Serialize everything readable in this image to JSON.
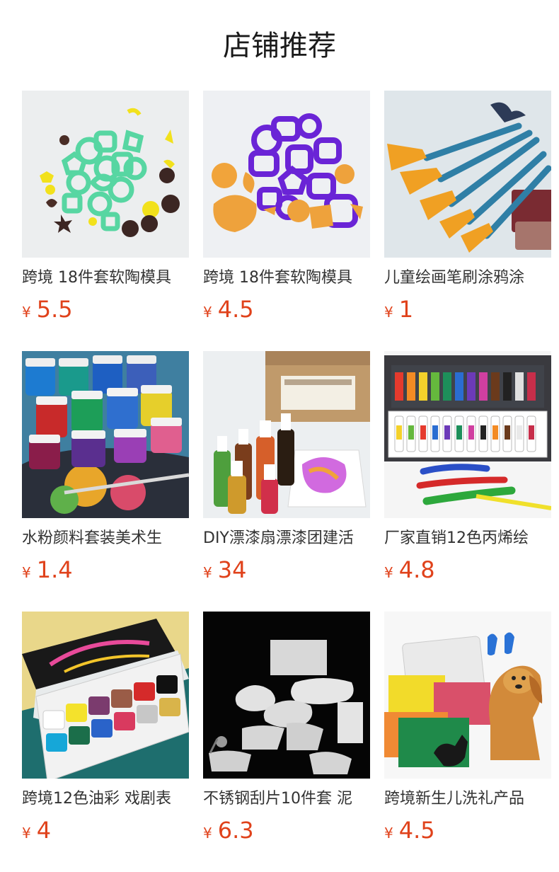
{
  "page_title": "店铺推荐",
  "currency": "¥",
  "products": [
    {
      "name": "跨境 18件套软陶模具",
      "price": "5.5",
      "image": "green-clay-cutters"
    },
    {
      "name": "跨境 18件套软陶模具",
      "price": "4.5",
      "image": "purple-clay-cutters"
    },
    {
      "name": "儿童绘画笔刷涂鸦涂",
      "price": "1",
      "image": "paint-brushes"
    },
    {
      "name": "水粉颜料套装美术生",
      "price": "1.4",
      "image": "gouache-paint-jars"
    },
    {
      "name": "DIY漂漆扇漂漆团建活",
      "price": "34",
      "image": "marbling-paint-bottles"
    },
    {
      "name": "厂家直销12色丙烯绘",
      "price": "4.8",
      "image": "acrylic-paint-tubes"
    },
    {
      "name": "跨境12色油彩 戏剧表",
      "price": "4",
      "image": "face-paint-palette"
    },
    {
      "name": "不锈钢刮片10件套 泥",
      "price": "6.3",
      "image": "steel-scrapers"
    },
    {
      "name": "跨境新生儿洗礼产品",
      "price": "4.5",
      "image": "baby-ink-pad"
    }
  ]
}
